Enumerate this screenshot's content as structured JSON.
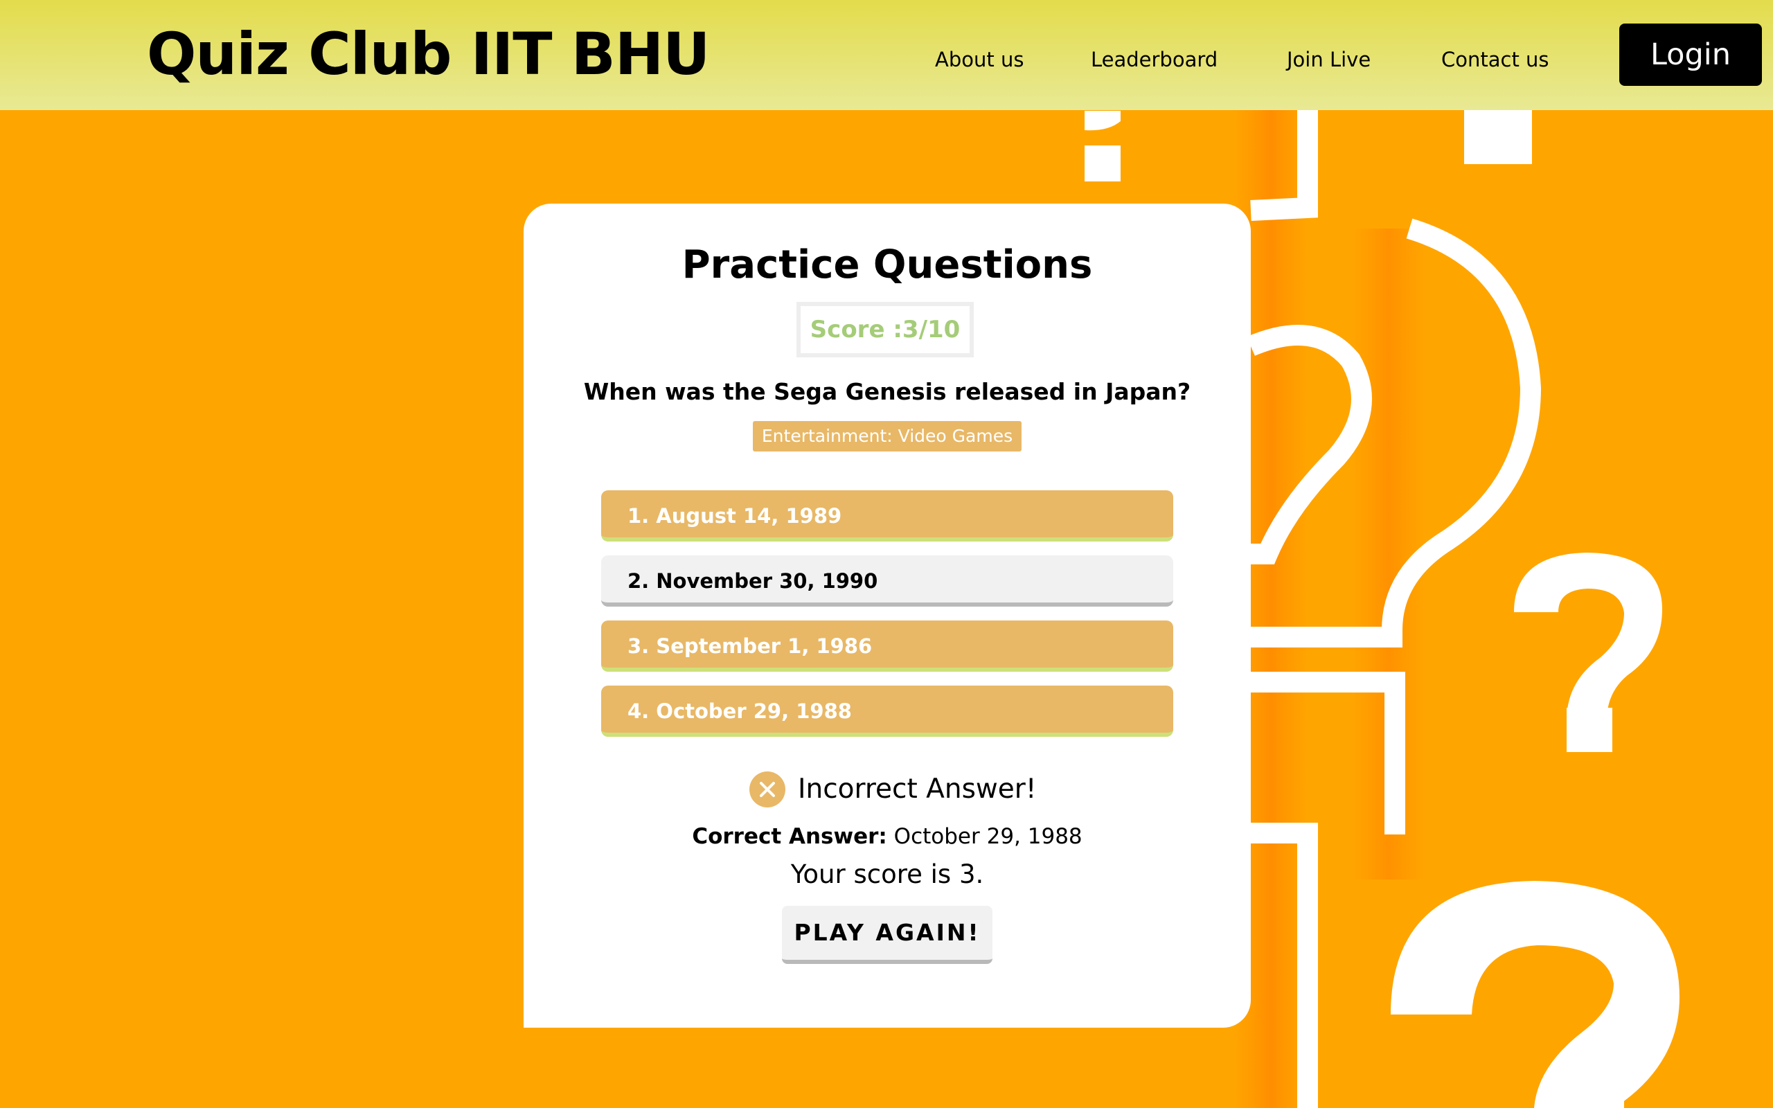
{
  "header": {
    "brand": "Quiz Club IIT BHU",
    "nav": [
      "About us",
      "Leaderboard",
      "Join Live",
      "Contact us"
    ],
    "login_label": "Login"
  },
  "quiz": {
    "title": "Practice Questions",
    "score_label": "Score :3/10",
    "question": "When was the Sega Genesis released in Japan?",
    "category": "Entertainment: Video Games",
    "options": [
      {
        "label": "1. August 14, 1989",
        "state": "incorrect"
      },
      {
        "label": "2. November 30, 1990",
        "state": "neutral"
      },
      {
        "label": "3. September 1, 1986",
        "state": "incorrect"
      },
      {
        "label": "4. October 29, 1988",
        "state": "incorrect"
      }
    ],
    "result": "Incorrect Answer!",
    "correct_label": "Correct Answer:",
    "correct_value": " October 29, 1988",
    "final_score": "Your score is 3.",
    "play_again": "PLAY AGAIN!"
  },
  "colors": {
    "background": "#ffa500",
    "header_gradient_top": "#e3dc4c",
    "header_gradient_bottom": "#e8e994",
    "option_incorrect": "#e8b867",
    "score_text": "#a5cc78"
  },
  "icons": {
    "result": "close-circle-icon",
    "background_art": "question-mark-icon"
  }
}
